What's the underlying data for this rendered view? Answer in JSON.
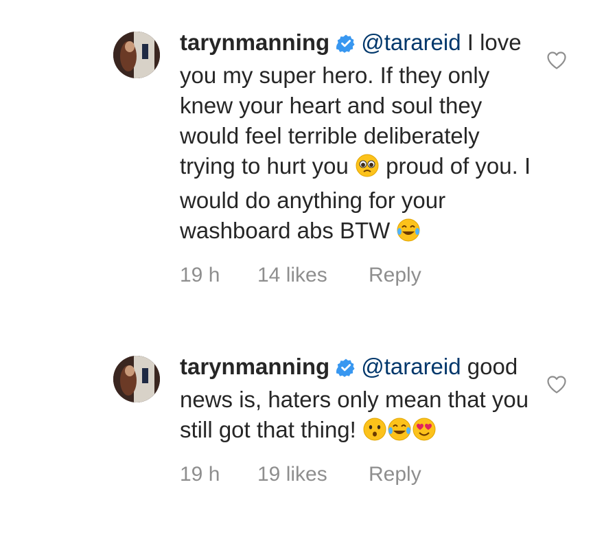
{
  "comments": [
    {
      "username": "tarynmanning",
      "mention": "@tarareid",
      "text_part1": "I love you my super hero. If they only knew your heart and soul they would feel terrible deliberately trying to hurt you",
      "text_part2": "proud of you. I would do anything for your washboard abs BTW",
      "emojis": [
        "pleading-face",
        "tears-of-joy-face"
      ],
      "time": "19 h",
      "likes": "14 likes",
      "reply_label": "Reply"
    },
    {
      "username": "tarynmanning",
      "mention": "@tarareid",
      "text_part1": "good news is, haters only mean that you still got that thing!",
      "emojis": [
        "hushed-face",
        "tears-of-joy-face",
        "heart-eyes-face"
      ],
      "time": "19 h",
      "likes": "19 likes",
      "reply_label": "Reply"
    }
  ],
  "colors": {
    "text": "#262626",
    "mention": "#00376b",
    "meta": "#8e8e8e",
    "verified": "#3897f0",
    "emoji_yellow": "#fcc21b"
  }
}
